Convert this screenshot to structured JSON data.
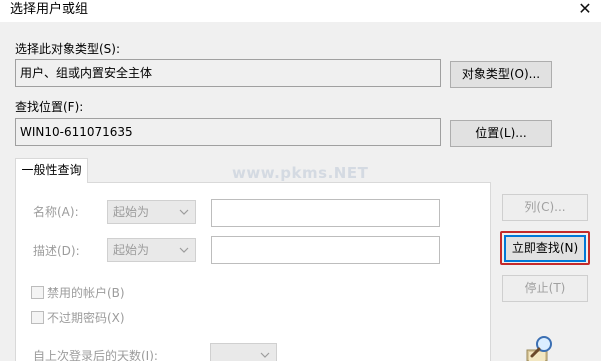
{
  "window": {
    "title": "选择用户或组",
    "close_glyph": "✕"
  },
  "object_type": {
    "label": "选择此对象类型(S):",
    "value": "用户、组或内置安全主体",
    "button": "对象类型(O)..."
  },
  "location": {
    "label": "查找位置(F):",
    "value": "WIN10-611071635",
    "button": "位置(L)..."
  },
  "query": {
    "tab": "一般性查询",
    "name_label": "名称(A):",
    "name_match": "起始为",
    "desc_label": "描述(D):",
    "desc_match": "起始为",
    "disabled_accounts": "禁用的帐户(B)",
    "non_expiring_password": "不过期密码(X)",
    "days_since_logon_label": "自上次登录后的天数(I):"
  },
  "buttons": {
    "columns": "列(C)...",
    "find_now": "立即查找(N)",
    "stop": "停止(T)"
  },
  "watermark": "www.pkms.NET",
  "colors": {
    "highlight": "#c42a2a",
    "focus": "#0078d7"
  },
  "icons": {
    "close": "close-icon",
    "search": "magnifier-icon"
  }
}
